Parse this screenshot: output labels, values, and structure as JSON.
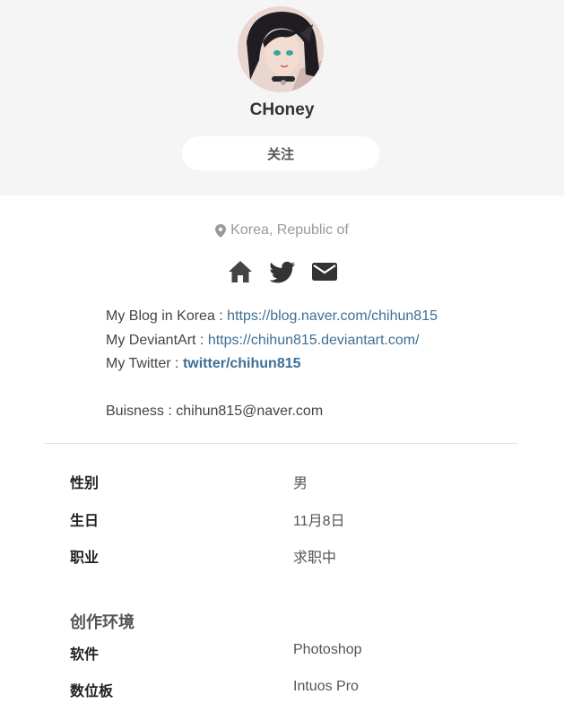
{
  "profile": {
    "username": "CHoney",
    "follow_label": "关注",
    "location": "Korea, Republic of"
  },
  "social_icons": [
    "home-icon",
    "twitter-icon",
    "envelope-icon"
  ],
  "bio": {
    "blog_prefix": "My Blog in Korea : ",
    "blog_link": "https://blog.naver.com/chihun815",
    "deviant_prefix": "My DeviantArt : ",
    "deviant_link": "https://chihun815.deviantart.com/",
    "twitter_prefix": "My Twitter : ",
    "twitter_link": "twitter/chihun815",
    "business": "Buisness : chihun815@naver.com"
  },
  "details": [
    {
      "label": "性别",
      "value": "男"
    },
    {
      "label": "生日",
      "value": "11月8日"
    },
    {
      "label": "职业",
      "value": "求职中"
    }
  ],
  "environment": {
    "title": "创作环境",
    "items": [
      {
        "label": "软件",
        "value": "Photoshop"
      },
      {
        "label": "数位板",
        "value": "Intuos Pro"
      }
    ]
  },
  "colors": {
    "header_bg": "#f5f5f5",
    "link": "#3d6f96",
    "icon": "#333333"
  }
}
